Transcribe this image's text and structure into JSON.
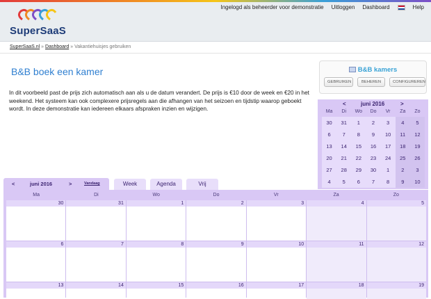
{
  "header": {
    "logo_text": "SuperSaaS",
    "nav": [
      "Ingelogd als beheerder voor demonstratie",
      "Uitloggen",
      "Dashboard"
    ],
    "help": "Help"
  },
  "breadcrumb": {
    "home": "SuperSaaS.nl",
    "dashboard": "Dashboard",
    "sep": "»",
    "current": "Vakantiehuisjes gebruiken"
  },
  "page": {
    "title": "B&B boek een kamer",
    "intro": "In dit voorbeeld past de prijs zich automatisch aan als u de datum verandert. De prijs is €10 door de week en €20 in het weekend. Het systeem kan ook complexere prijsregels aan die afhangen van het seizoen en tijdstip waarop geboekt wordt. In deze demonstratie kan iedereen elkaars afspraken inzien en wijzigen."
  },
  "resource": {
    "name": "B&B kamers",
    "buttons": [
      "GEBRUIKEN",
      "BEHEREN",
      "CONFIGUREREN"
    ]
  },
  "mini_calendar": {
    "prev": "<",
    "title": "juni 2016",
    "next": ">",
    "dows": [
      "Ma",
      "Di",
      "Wo",
      "Do",
      "Vr",
      "Za",
      "Zo"
    ],
    "weeks": [
      [
        "30",
        "31",
        "1",
        "2",
        "3",
        "4",
        "5"
      ],
      [
        "6",
        "7",
        "8",
        "9",
        "10",
        "11",
        "12"
      ],
      [
        "13",
        "14",
        "15",
        "16",
        "17",
        "18",
        "19"
      ],
      [
        "20",
        "21",
        "22",
        "23",
        "24",
        "25",
        "26"
      ],
      [
        "27",
        "28",
        "29",
        "30",
        "1",
        "2",
        "3"
      ],
      [
        "4",
        "5",
        "6",
        "7",
        "8",
        "9",
        "10"
      ]
    ]
  },
  "calendar": {
    "prev": "<",
    "title": "juni 2016",
    "next": ">",
    "today": "Vandaag",
    "views": [
      "Week",
      "Agenda",
      "Vrij"
    ],
    "dows": [
      "Ma",
      "Di",
      "Wo",
      "Do",
      "Vr",
      "Za",
      "Zo"
    ],
    "weeks": [
      [
        "30",
        "31",
        "1",
        "2",
        "3",
        "4",
        "5"
      ],
      [
        "6",
        "7",
        "8",
        "9",
        "10",
        "11",
        "12"
      ],
      [
        "13",
        "14",
        "15",
        "16",
        "17",
        "18",
        "19"
      ]
    ]
  }
}
